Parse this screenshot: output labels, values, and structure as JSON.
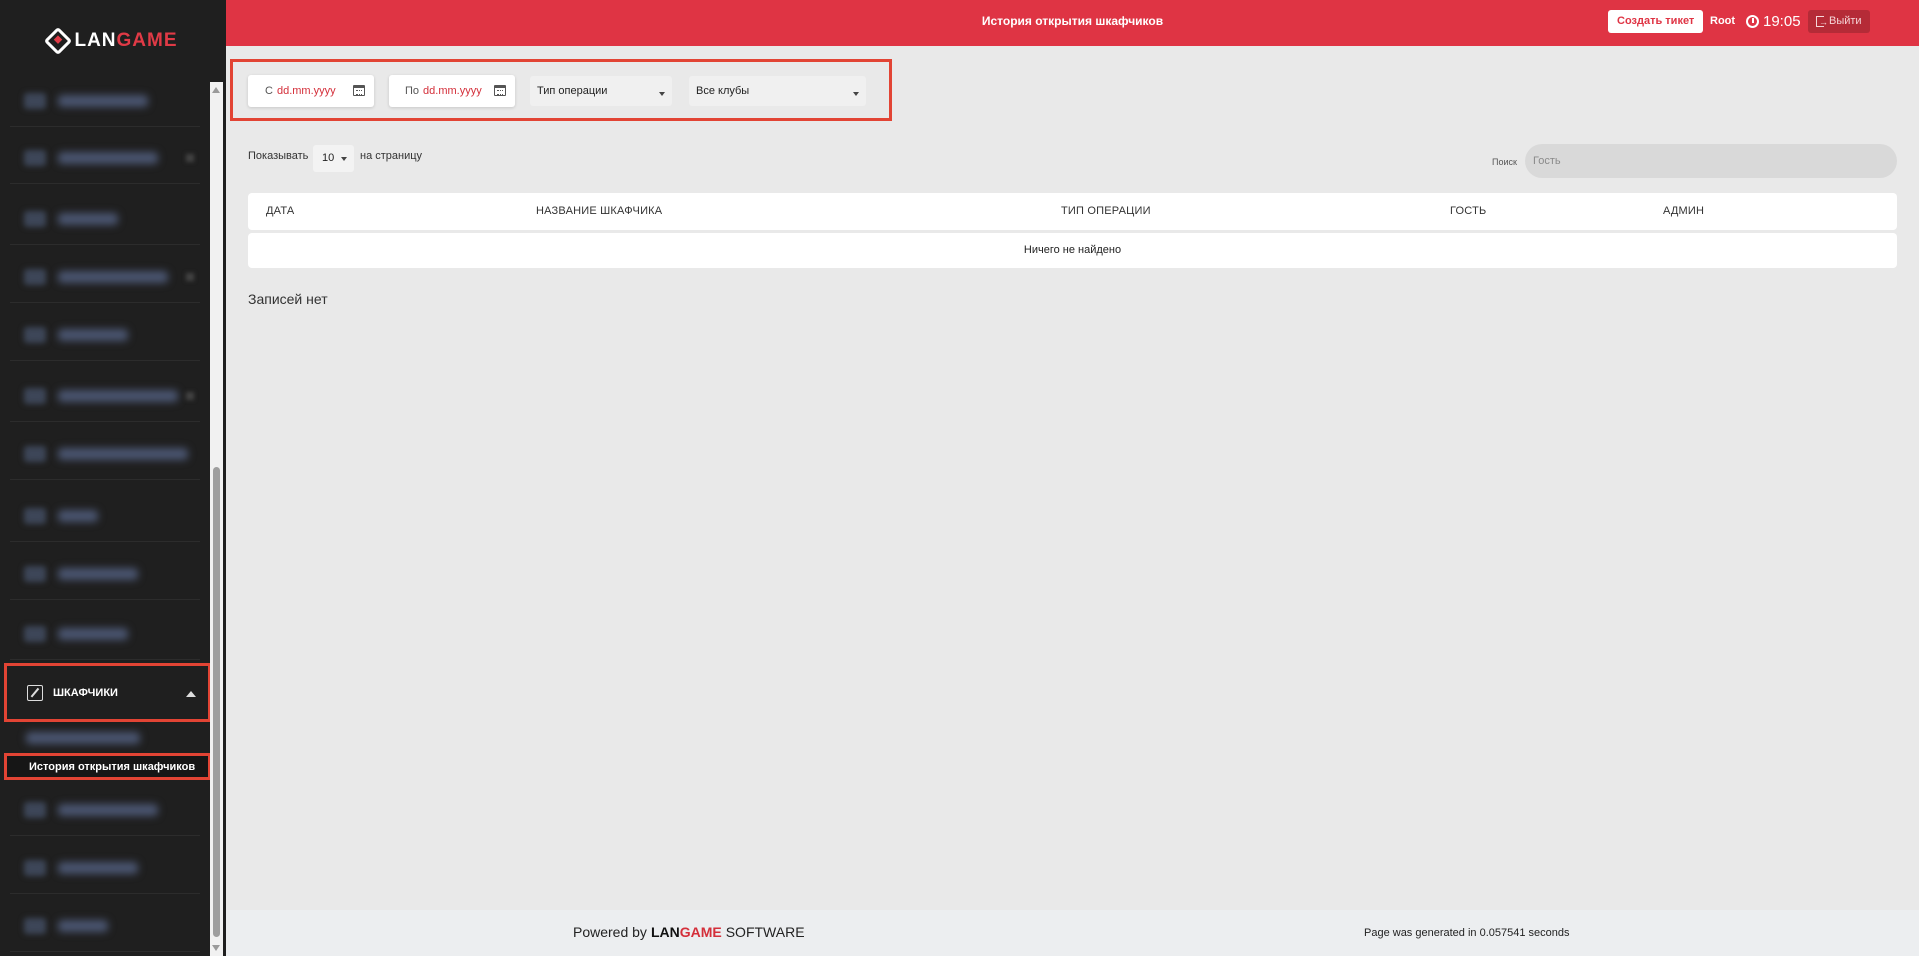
{
  "sidebar": {
    "logo": {
      "prefix": "LAN",
      "suffix": "GAME"
    },
    "active_section": {
      "label": "ШКАФЧИКИ",
      "icon": "edit-icon"
    },
    "active_item": {
      "label": "История открытия шкафчиков"
    }
  },
  "header": {
    "title": "История открытия шкафчиков",
    "create_ticket": "Создать тикет",
    "user": "Root",
    "time": "19:05",
    "logout": "Выйти"
  },
  "filters": {
    "from_prefix": "С",
    "from_placeholder": "dd.mm.yyyy",
    "to_prefix": "По",
    "to_placeholder": "dd.mm.yyyy",
    "operation_type": "Тип операции",
    "clubs": "Все клубы"
  },
  "table": {
    "show_label": "Показывать",
    "per_page": "10",
    "per_page_suffix": "на страницу",
    "search_label": "Поиск",
    "search_placeholder": "Гость",
    "columns": [
      "ДАТА",
      "НАЗВАНИЕ ШКАФЧИКА",
      "ТИП ОПЕРАЦИИ",
      "ГОСТЬ",
      "АДМИН"
    ],
    "empty_message": "Ничего не найдено",
    "no_records": "Записей нет"
  },
  "footer": {
    "powered_by": "Powered by",
    "brand_prefix": "LAN",
    "brand_suffix": "GAME",
    "software": "SOFTWARE",
    "generated": "Page was generated in 0.057541 seconds"
  },
  "colors": {
    "accent": "#df3444",
    "sidebar_bg": "#1f1f1f",
    "highlight": "#e24434"
  }
}
